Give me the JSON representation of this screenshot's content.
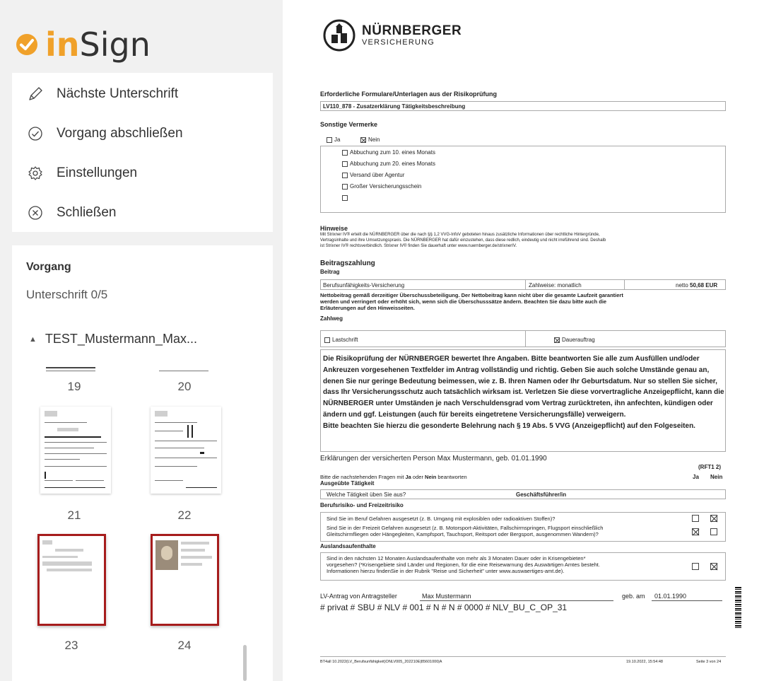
{
  "app": {
    "brand_in": "in",
    "brand_sign": "Sign",
    "accent_color": "#f0a12a",
    "selection_color": "#a61c1c"
  },
  "menu": {
    "items": [
      {
        "label": "Nächste Unterschrift",
        "icon": "pen-icon"
      },
      {
        "label": "Vorgang abschließen",
        "icon": "check-circle-icon"
      },
      {
        "label": "Einstellungen",
        "icon": "gear-icon"
      },
      {
        "label": "Schließen",
        "icon": "close-circle-icon"
      }
    ]
  },
  "vorgang": {
    "title": "Vorgang",
    "signature_status": "Unterschrift 0/5",
    "document_name": "TEST_Mustermann_Max...",
    "pages": [
      {
        "label": "19",
        "selected": false
      },
      {
        "label": "20",
        "selected": false
      },
      {
        "label": "21",
        "selected": false
      },
      {
        "label": "22",
        "selected": false
      },
      {
        "label": "23",
        "selected": true
      },
      {
        "label": "24",
        "selected": true
      }
    ]
  },
  "document": {
    "logo_name": "NÜRNBERGER",
    "logo_sub": "VERSICHERUNG",
    "s1_title": "Erforderliche Formulare/Unterlagen aus der Risikoprüfung",
    "s1_value": "LV110_878 - Zusatzerklärung Tätigkeitsbeschreibung",
    "s2_title": "Sonstige Vermerke",
    "s2_ja": "Ja",
    "s2_nein": "Nein",
    "s2_options": [
      "Abbuchung zum 10. eines Monats",
      "Abbuchung zum 20. eines Monats",
      "Versand über Agentur",
      "Großer Versicherungsschein"
    ],
    "hinweise_title": "Hinweise",
    "hinweise_lines": [
      "Mit Strixner IV® erteilt die NÜRNBERGER über die nach §§ 1,2 VVG-InfoV geboteten hinaus zusätzliche Informationen über rechtliche Hintergründe,",
      "Vertragsinhalte und ihre Umsetzungspraxis. Die NÜRNBERGER hat dafür einzustehen, dass diese redlich, eindeutig und nicht irreführend sind. Deshalb",
      "ist Strixner IV® rechtsverbindlich. Strixner IV® finden Sie dauerhaft unter www.nuernberger.de/strixnerIV."
    ],
    "beitrag_title": "Beitragszahlung",
    "beitrag_sub": "Beitrag",
    "beitrag_product": "Berufsunfähigkeits-Versicherung",
    "beitrag_zahlweise": "Zahlweise: monatlich",
    "beitrag_netto": "netto",
    "beitrag_amount": "50,68 EUR",
    "netto_lines": [
      "Nettobeitrag gemäß derzeitiger Überschussbeteiligung. Der Nettobeitrag kann nicht über die gesamte Laufzeit garantiert",
      "werden und verringert oder erhöht sich, wenn sich die Überschusssätze ändern. Beachten Sie dazu bitte auch die",
      "Erläuterungen auf den Hinweisseiten."
    ],
    "zahlweg_title": "Zahlweg",
    "zahlweg_lastschrift": "Lastschrift",
    "zahlweg_dauerauftrag": "Dauerauftrag",
    "risk_text": "Die Risikoprüfung der NÜRNBERGER bewertet Ihre Angaben. Bitte beantworten Sie alle zum Ausfüllen und/oder Ankreuzen vorgesehenen Textfelder im Antrag vollständig und richtig. Geben Sie auch solche Umstände genau an, denen Sie nur geringe Bedeutung beimessen, wie z. B. Ihren Namen oder Ihr Geburtsdatum. Nur so stellen Sie sicher, dass Ihr Versicherungsschutz auch tatsächlich wirksam ist. Verletzen Sie diese vorvertragliche Anzeigepflicht, kann die NÜRNBERGER unter Umständen je nach Verschuldensgrad vom Vertrag zurücktreten, ihn anfechten, kündigen oder ändern und ggf. Leistungen (auch für bereits eingetretene Versicherungsfälle) verweigern.",
    "risk_text2": "Bitte beachten Sie hierzu die gesonderte Belehrung nach § 19 Abs. 5 VVG (Anzeigepflicht) auf den Folgeseiten.",
    "erkl_title": "Erklärungen der versicherten Person Max Mustermann, geb. 01.01.1990",
    "rft": "(RFT1 2)",
    "fragen_intro_a": "Bitte die nachstehenden Fragen mit ",
    "fragen_ja": "Ja",
    "fragen_oder": " oder ",
    "fragen_nein": "Nein",
    "fragen_intro_b": " beantworten",
    "col_ja": "Ja",
    "col_nein": "Nein",
    "taetigkeit_title": "Ausgeübte Tätigkeit",
    "taetigkeit_q": "Welche Tätigkeit üben Sie aus?",
    "taetigkeit_a": "Geschäftsführer/in",
    "risiko_title": "Berufsrisiko- und Freizeitrisiko",
    "risiko_q1": "Sind Sie im Beruf Gefahren ausgesetzt (z. B. Umgang mit explosiblen oder radioaktiven Stoffen)?",
    "risiko_q2a": "Sind Sie in der Freizeit Gefahren ausgesetzt (z. B. Motorsport-Aktivitäten, Fallschirmspringen, Flugsport einschließlich",
    "risiko_q2b": "Gleitschirmfliegen oder Hängegleiten, Kampfsport, Tauchsport, Reitsport oder Bergsport, ausgenommen Wandern)?",
    "ausland_title": "Auslandsaufenthalte",
    "ausland_q_a": "Sind in den nächsten 12 Monaten Auslandsaufenthalte von mehr als 3 Monaten Dauer oder in Krisengebieten*",
    "ausland_q_b": "vorgesehen? (*Krisengebiete sind Länder und Regionen, für die eine Reisewarnung des Auswärtigen Amtes besteht.",
    "ausland_q_c": "Informationen hierzu findenSie in der Rubrik \"Reise und Sicherheit\" unter www.auswaertiges-amt.de).",
    "lv_label": "LV-Antrag von Antragsteller",
    "lv_name": "Max Mustermann",
    "geb_label": "geb. am",
    "geb_date": "01.01.1990",
    "code_line": "# privat # SBU # NLV # 001 # N # N # 0000 # NLV_BU_C_OP_31",
    "footer_left": "BT4all 10.2022(LV_Berufsunfähigkeit)ONLV005_202210E|85601000|A",
    "footer_date": "19.10.2022, 15:54:48",
    "footer_page": "Seite 3 von 24"
  }
}
